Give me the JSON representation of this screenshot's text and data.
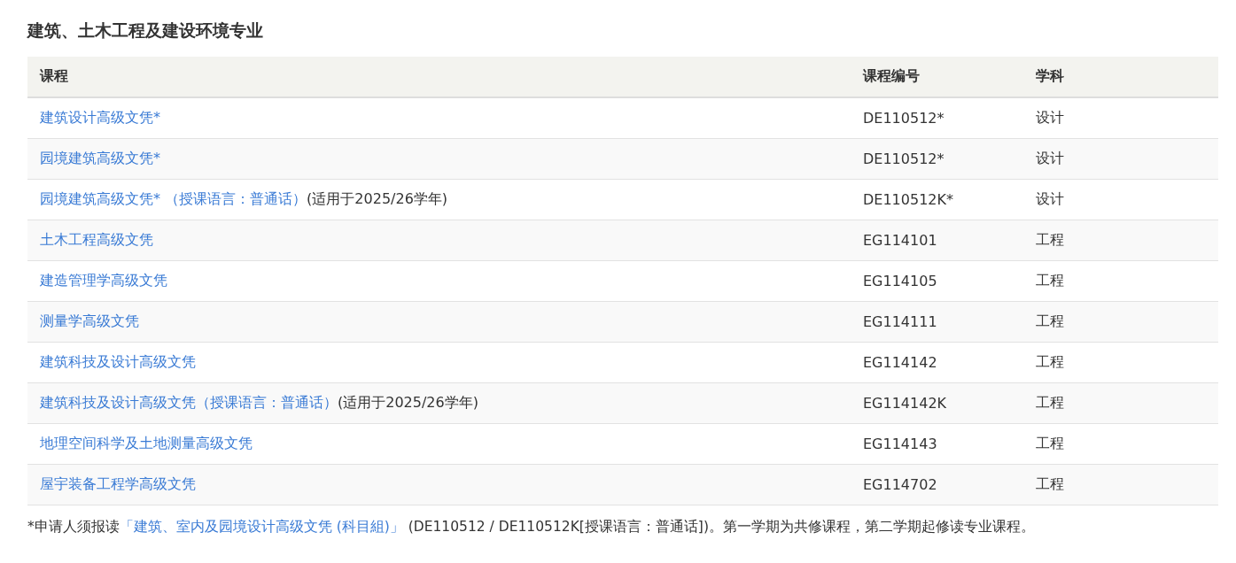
{
  "title": "建筑、土木工程及建设环境专业",
  "table": {
    "columns": [
      "课程",
      "课程编号",
      "学科"
    ],
    "rows": [
      {
        "course": "建筑设计高级文凭*",
        "code": "DE110512*",
        "subject": "设计"
      },
      {
        "course": "园境建筑高级文凭*",
        "code": "DE110512*",
        "subject": "设计"
      },
      {
        "course": "园境建筑高级文凭* （授课语言：普通话）",
        "note": "(适用于2025/26学年)",
        "code": "DE110512K*",
        "subject": "设计"
      },
      {
        "course": "土木工程高级文凭",
        "code": "EG114101",
        "subject": "工程"
      },
      {
        "course": "建造管理学高级文凭",
        "code": "EG114105",
        "subject": "工程"
      },
      {
        "course": "测量学高级文凭",
        "code": "EG114111",
        "subject": "工程"
      },
      {
        "course": "建筑科技及设计高级文凭",
        "code": "EG114142",
        "subject": "工程"
      },
      {
        "course": "建筑科技及设计高级文凭（授课语言：普通话）",
        "note": "(适用于2025/26学年)",
        "code": "EG114142K",
        "subject": "工程"
      },
      {
        "course": "地理空间科学及土地测量高级文凭",
        "code": "EG114143",
        "subject": "工程"
      },
      {
        "course": "屋宇装备工程学高级文凭",
        "code": "EG114702",
        "subject": "工程"
      }
    ]
  },
  "footnote": {
    "prefix": "*申请人须报读",
    "link": "「建筑、室内及园境设计高级文凭 (科目組)」",
    "suffix": "(DE110512 / DE110512K[授课语言：普通话])。第一学期为共修课程，第二学期起修读专业课程。"
  }
}
